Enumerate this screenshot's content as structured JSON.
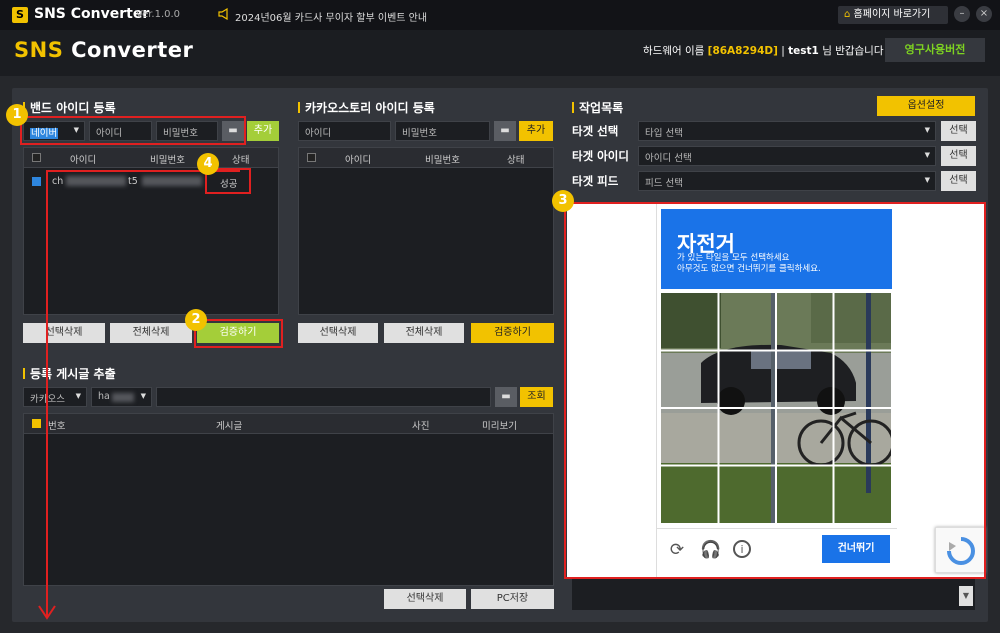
{
  "titlebar": {
    "logo": "S",
    "app": "SNS Converter",
    "version": "Ver.1.0.0",
    "notice": "2024년06월 카드사 무이자 할부 이벤트 안내",
    "home": "홈페이지 바로가기",
    "min": "–",
    "close": "×"
  },
  "header": {
    "brand_a": "SNS",
    "brand_b": " Converter",
    "welcome_pre": "하드웨어 이름 ",
    "hw": "[86A8294D]",
    "sep": " | ",
    "user": "test1",
    "welcome_post": " 님 반갑습니다",
    "perm": "영구사용버전"
  },
  "band": {
    "title": "밴드 아이디 등록",
    "site": "네이버",
    "id_ph": "아이디",
    "pw_ph": "비밀번호",
    "add": "추가",
    "cols": [
      "아이디",
      "비밀번호",
      "상태"
    ],
    "row": {
      "id": "ch",
      "pw": "t5",
      "status": "성공"
    },
    "del_sel": "선택삭제",
    "del_all": "전체삭제",
    "verify": "검증하기"
  },
  "kakao": {
    "title": "카카오스토리 아이디 등록",
    "id_ph": "아이디",
    "pw_ph": "비밀번호",
    "add": "추가",
    "cols": [
      "아이디",
      "비밀번호",
      "상태"
    ],
    "del_sel": "선택삭제",
    "del_all": "전체삭제",
    "verify": "검증하기"
  },
  "posts": {
    "title": "등록 게시글 추출",
    "source": "카카오스",
    "account": "ha",
    "search": "조회",
    "cols": [
      "번호",
      "게시글",
      "사진",
      "미리보기"
    ],
    "del_sel": "선택삭제",
    "save": "PC저장"
  },
  "work": {
    "title": "작업목록",
    "options": "옵션설정",
    "rows": [
      {
        "label": "타겟 선택",
        "value": "타입 선택",
        "btn": "선택"
      },
      {
        "label": "타겟 아이디",
        "value": "아이디 선택",
        "btn": "선택"
      },
      {
        "label": "타겟 피드",
        "value": "피드 선택",
        "btn": "선택"
      }
    ]
  },
  "captcha": {
    "title": "자전거",
    "line1": "가 있는 타일을 모두 선택하세요",
    "line2": "아무것도 없으면 건너뛰기를 클릭하세요.",
    "skip": "건너뛰기"
  },
  "markers": [
    "1",
    "2",
    "3",
    "4"
  ],
  "colors": {
    "accent": "#f2c200",
    "green": "#a4ce39",
    "blue": "#1a73e8",
    "red": "#e02020"
  }
}
